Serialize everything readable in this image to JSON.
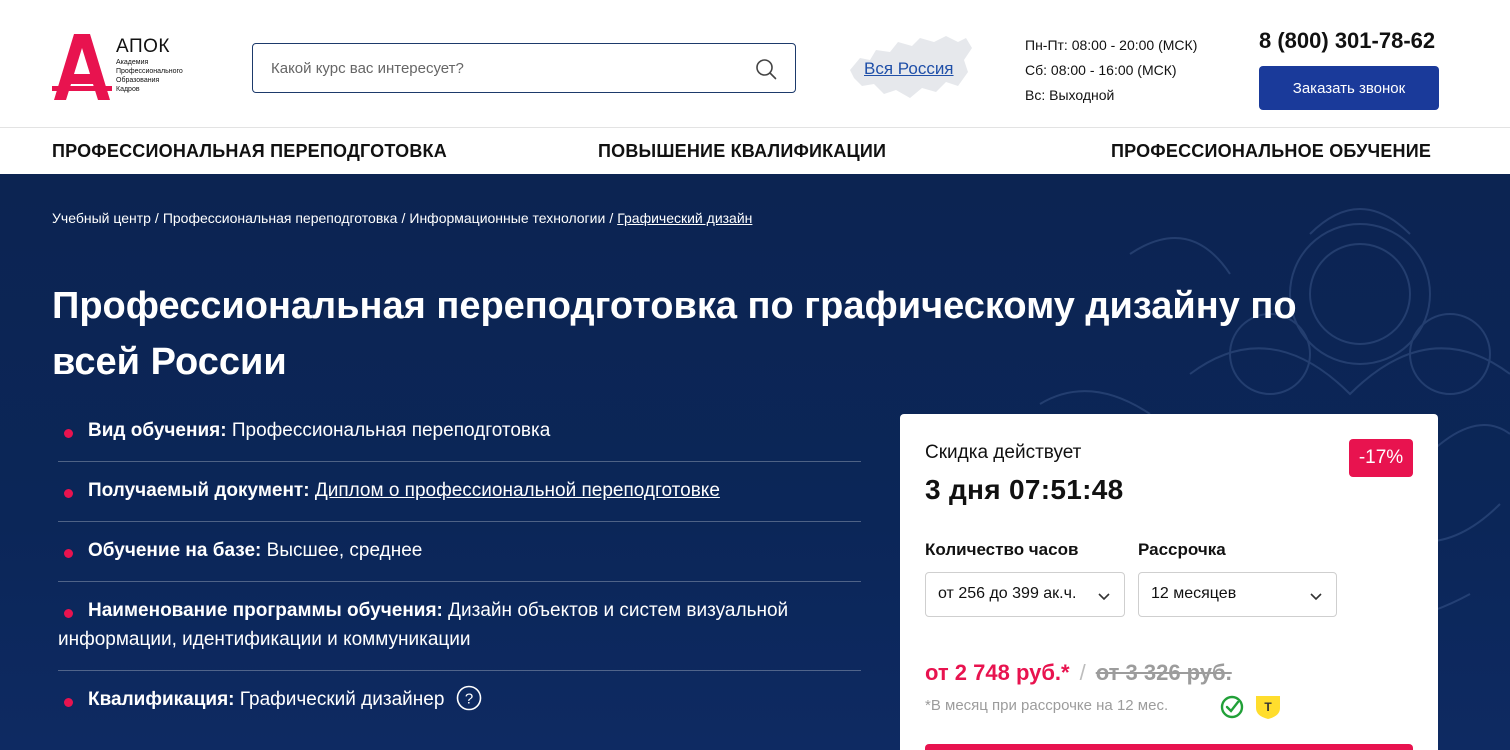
{
  "header": {
    "logo": {
      "title": "АПОК",
      "subtitle_lines": [
        "Академия",
        "Профессионального",
        "Образования",
        "Кадров"
      ],
      "mark_letter": "А",
      "mark_color": "#e8134f"
    },
    "search": {
      "placeholder": "Какой курс вас интересует?",
      "value": ""
    },
    "region_link": "Вся Россия",
    "hours": [
      "Пн-Пт: 08:00 - 20:00 (МСК)",
      "Сб: 08:00 - 16:00 (МСК)",
      "Вс: Выходной"
    ],
    "phone": "8 (800) 301-78-62",
    "callback_button": "Заказать звонок"
  },
  "nav": {
    "items": [
      "ПРОФЕССИОНАЛЬНАЯ ПЕРЕПОДГОТОВКА",
      "ПОВЫШЕНИЕ КВАЛИФИКАЦИИ",
      "ПРОФЕССИОНАЛЬНОЕ ОБУЧЕНИЕ"
    ]
  },
  "breadcrumb": {
    "items": [
      "Учебный центр",
      "Профессиональная переподготовка",
      "Информационные технологии",
      "Графический дизайн"
    ],
    "separator": "/"
  },
  "page_title": "Профессиональная переподготовка по графическому дизайну по всей России",
  "facts": [
    {
      "key": "Вид обучения:",
      "value": "Профессиональная переподготовка"
    },
    {
      "key": "Получаемый документ:",
      "value": "Диплом о профессиональной переподготовке"
    },
    {
      "key": "Обучение на базе:",
      "value": "Высшее, среднее"
    },
    {
      "key": "Наименование программы обучения:",
      "value": "Дизайн объектов и систем визуальной информации, идентификации и коммуникации"
    },
    {
      "key": "Квалификация:",
      "value": "Графический дизайнер"
    }
  ],
  "price_card": {
    "discount_label": "Скидка действует",
    "timer": "3 дня 07:51:48",
    "badge": "-17%",
    "hours_label": "Количество часов",
    "hours_value": "от 256 до 399 ак.ч.",
    "installment_label": "Рассрочка",
    "installment_value": "12 месяцев",
    "price_now": "от 2 748 руб.*",
    "price_separator": "/",
    "price_old": "от 3 326 руб.",
    "price_note": "*В месяц при рассрочке на 12 мес."
  },
  "colors": {
    "accent": "#e8134f",
    "brand_blue": "#1a3a9a",
    "hero_bg": "#0b2658",
    "link": "#1f4fa8"
  }
}
